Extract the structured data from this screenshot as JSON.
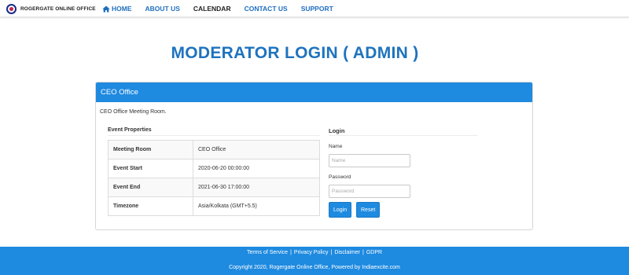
{
  "brand": {
    "name": "ROGERGATE ONLINE OFFICE"
  },
  "nav": {
    "items": [
      {
        "label": "HOME",
        "icon": "home-icon"
      },
      {
        "label": "ABOUT US"
      },
      {
        "label": "CALENDAR",
        "active": true
      },
      {
        "label": "CONTACT US"
      },
      {
        "label": "SUPPORT"
      }
    ]
  },
  "page": {
    "title": "MODERATOR LOGIN ( ADMIN )"
  },
  "panel": {
    "heading": "CEO Office",
    "description": "CEO Office Meeting Room."
  },
  "event_properties": {
    "title": "Event Properties",
    "rows": [
      {
        "key": "Meeting Room",
        "value": "CEO Office"
      },
      {
        "key": "Event Start",
        "value": "2020-06-20 00:00:00"
      },
      {
        "key": "Event End",
        "value": "2021-06-30 17:00:00"
      },
      {
        "key": "Timezone",
        "value": "Asia/Kolkata (GMT+5.5)"
      }
    ]
  },
  "login": {
    "title": "Login",
    "name_label": "Name",
    "name_placeholder": "Name",
    "password_label": "Password",
    "password_placeholder": "Password",
    "login_button": "Login",
    "reset_button": "Reset"
  },
  "footer": {
    "links": [
      "Terms of Service",
      "Privacy Policy",
      "Disclaimer",
      "GDPR"
    ],
    "separator": "|",
    "copyright": "Copyright 2020, Rogergate Online Office, Powered by Indiaexcite.com"
  },
  "colors": {
    "accent": "#1e8ae0",
    "title": "#1e73be",
    "nav_link": "#1e6fc0"
  }
}
